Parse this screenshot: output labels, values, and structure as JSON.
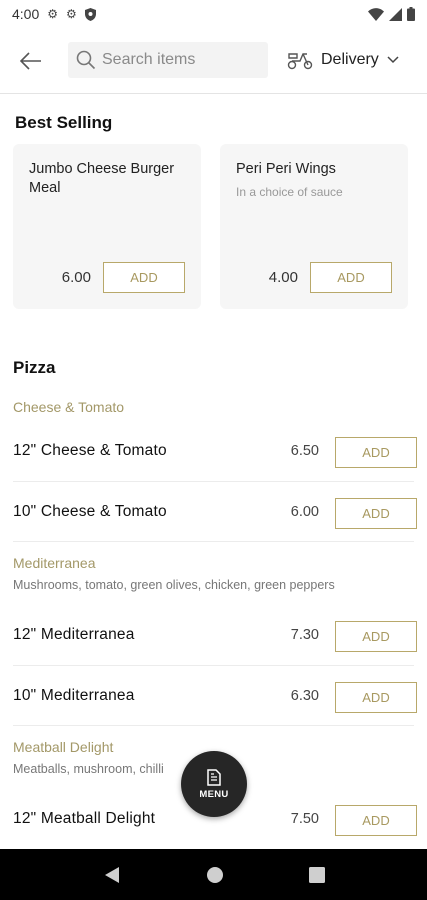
{
  "status_bar": {
    "time": "4:00"
  },
  "header": {
    "search_placeholder": "Search items",
    "delivery_label": "Delivery"
  },
  "best_selling": {
    "title": "Best Selling",
    "items": [
      {
        "name": "Jumbo Cheese Burger Meal",
        "description": "",
        "price": "6.00",
        "add_label": "ADD"
      },
      {
        "name": "Peri Peri Wings",
        "description": "In a choice of sauce",
        "price": "4.00",
        "add_label": "ADD"
      }
    ]
  },
  "pizza": {
    "title": "Pizza",
    "groups": [
      {
        "name": "Cheese & Tomato",
        "description": "",
        "items": [
          {
            "name": "12\" Cheese & Tomato",
            "price": "6.50",
            "add_label": "ADD"
          },
          {
            "name": "10\" Cheese & Tomato",
            "price": "6.00",
            "add_label": "ADD"
          }
        ]
      },
      {
        "name": "Mediterranea",
        "description": "Mushrooms, tomato, green olives, chicken, green peppers",
        "items": [
          {
            "name": "12\" Mediterranea",
            "price": "7.30",
            "add_label": "ADD"
          },
          {
            "name": "10\" Mediterranea",
            "price": "6.30",
            "add_label": "ADD"
          }
        ]
      },
      {
        "name": "Meatball Delight",
        "description": "Meatballs, mushroom, chilli",
        "items": [
          {
            "name": "12\" Meatball Delight",
            "price": "7.50",
            "add_label": "ADD"
          }
        ]
      }
    ]
  },
  "fab": {
    "label": "MENU"
  },
  "colors": {
    "accent": "#b8a86a",
    "subcategory": "#a39868",
    "fab": "#262626"
  }
}
